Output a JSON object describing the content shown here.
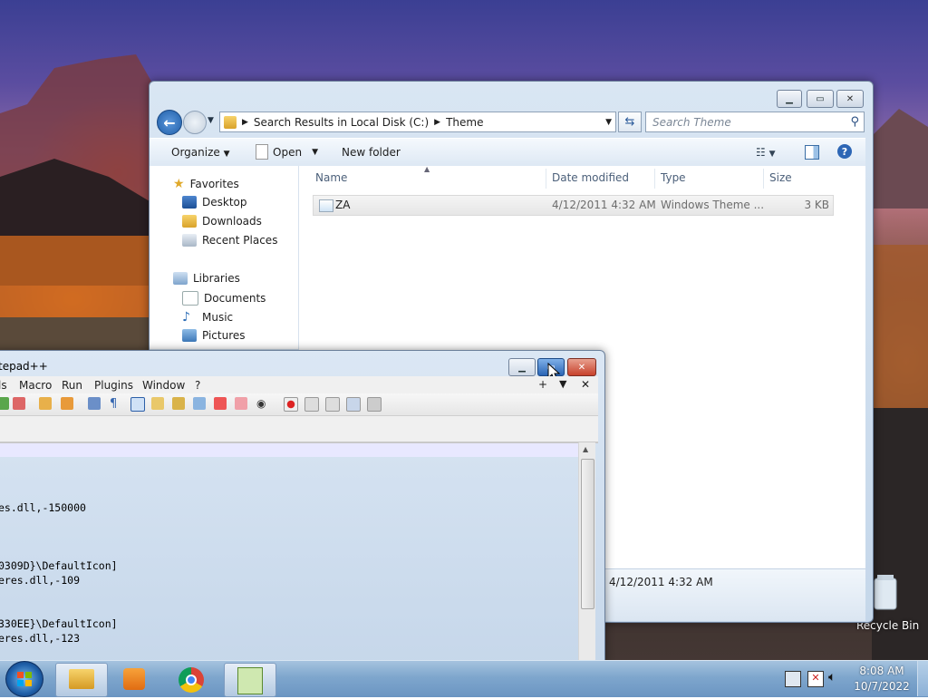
{
  "explorer": {
    "breadcrumb": [
      "Search Results in Local Disk (C:)",
      "Theme"
    ],
    "search_placeholder": "Search Theme",
    "toolbar": {
      "organize": "Organize",
      "open": "Open",
      "new_folder": "New folder"
    },
    "nav": {
      "favorites": "Favorites",
      "favorites_items": [
        "Desktop",
        "Downloads",
        "Recent Places"
      ],
      "libraries": "Libraries",
      "libraries_items": [
        "Documents",
        "Music",
        "Pictures"
      ]
    },
    "columns": {
      "name": "Name",
      "date": "Date modified",
      "type": "Type",
      "size": "Size"
    },
    "files": [
      {
        "name": "ZA",
        "date": "4/12/2011 4:32 AM",
        "type": "Windows Theme ...",
        "size": "3 KB"
      }
    ],
    "details_date": "4/12/2011 4:32 AM"
  },
  "notepad": {
    "title": "tepad++",
    "menu": [
      "ls",
      "Macro",
      "Run",
      "Plugins",
      "Window",
      "?"
    ],
    "menu_right": [
      "+",
      "▼",
      "✕"
    ],
    "lines": [
      "es.dll,-150000",
      "0309D}\\DefaultIcon]",
      "eres.dll,-109",
      "330EE}\\DefaultIcon]",
      "eres.dll,-123"
    ]
  },
  "desktop": {
    "recycle_bin": "Recycle Bin"
  },
  "taskbar": {
    "time": "8:08 AM",
    "date": "10/7/2022"
  },
  "colors": {
    "accent": "#3a78c2",
    "titlebar": "#d6e4f2",
    "close": "#c7412b"
  }
}
